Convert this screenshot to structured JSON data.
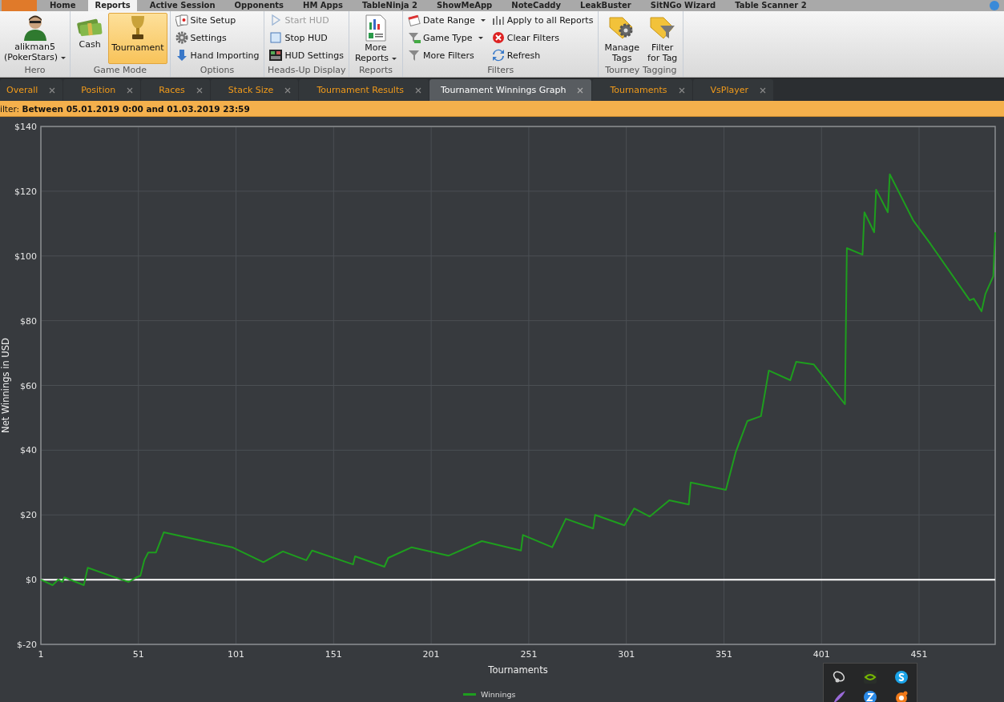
{
  "menu_tabs": [
    {
      "label": "Home",
      "selected": false
    },
    {
      "label": "Reports",
      "selected": true
    },
    {
      "label": "Active Session",
      "selected": false
    },
    {
      "label": "Opponents",
      "selected": false
    },
    {
      "label": "HM Apps",
      "selected": false
    },
    {
      "label": "TableNinja 2",
      "selected": false
    },
    {
      "label": "ShowMeApp",
      "selected": false
    },
    {
      "label": "NoteCaddy",
      "selected": false
    },
    {
      "label": "LeakBuster",
      "selected": false
    },
    {
      "label": "SitNGo Wizard",
      "selected": false
    },
    {
      "label": "Table Scanner 2",
      "selected": false
    }
  ],
  "ribbon": {
    "groups": [
      {
        "label": "Hero",
        "items": [
          {
            "kind": "hero",
            "label": "alikman5\n(PokerStars)",
            "dropdown": true
          }
        ]
      },
      {
        "label": "Game Mode",
        "items": [
          {
            "kind": "large",
            "label": "Cash",
            "selected": false
          },
          {
            "kind": "large",
            "label": "Tournament",
            "selected": true
          }
        ]
      },
      {
        "label": "Options",
        "items": [
          {
            "kind": "small",
            "label": "Site Setup"
          },
          {
            "kind": "small",
            "label": "Settings"
          },
          {
            "kind": "small",
            "label": "Hand Importing"
          }
        ]
      },
      {
        "label": "Heads-Up Display",
        "items": [
          {
            "kind": "small",
            "label": "Start HUD",
            "disabled": true
          },
          {
            "kind": "small",
            "label": "Stop HUD",
            "disabled": false
          },
          {
            "kind": "small",
            "label": "HUD Settings",
            "disabled": false
          }
        ]
      },
      {
        "label": "Reports",
        "items": [
          {
            "kind": "large",
            "label": "More\nReports",
            "dropdown": true,
            "selected": false
          }
        ]
      },
      {
        "label": "Filters",
        "items": [
          {
            "kind": "small",
            "label": "Date Range",
            "dropdown": true
          },
          {
            "kind": "small",
            "label": "Game Type",
            "dropdown": true
          },
          {
            "kind": "small",
            "label": "More Filters",
            "dropdown": false
          },
          {
            "kind": "small",
            "label": "Apply to all Reports",
            "dropdown": false
          },
          {
            "kind": "small",
            "label": "Clear Filters",
            "dropdown": false
          },
          {
            "kind": "small",
            "label": "Refresh",
            "dropdown": false
          }
        ]
      },
      {
        "label": "Tourney Tagging",
        "items": [
          {
            "kind": "large",
            "label": "Manage\nTags",
            "selected": false
          },
          {
            "kind": "large",
            "label": "Filter\nfor Tag",
            "selected": false
          }
        ]
      }
    ]
  },
  "tabs": [
    {
      "label": "Overall",
      "selected": false
    },
    {
      "label": "Position",
      "selected": false
    },
    {
      "label": "Races",
      "selected": false
    },
    {
      "label": "Stack Size",
      "selected": false
    },
    {
      "label": "Tournament Results",
      "selected": false
    },
    {
      "label": "Tournament Winnings Graph",
      "selected": true
    },
    {
      "label": "Tournaments",
      "selected": false
    },
    {
      "label": "VsPlayer",
      "selected": false
    }
  ],
  "filter_bar": {
    "text": "ilter: **Between 05.01.2019 0:00 and 01.03.2019 23:59**"
  },
  "chart": {
    "chart_data": {
      "type": "line",
      "xlabel": "Tournaments",
      "ylabel": "Net Winnings in USD",
      "x": [
        1,
        7,
        10,
        12,
        13,
        23,
        25,
        40,
        46,
        50,
        52,
        54,
        56,
        60,
        64,
        99,
        115,
        125,
        137,
        140,
        161,
        162,
        177,
        179,
        191,
        210,
        227,
        247,
        248,
        263,
        270,
        284,
        285,
        300,
        305,
        313,
        323,
        333,
        334,
        352,
        357,
        363,
        370,
        374,
        385,
        388,
        397,
        405,
        413,
        414,
        422,
        423,
        428,
        429,
        435,
        436,
        448,
        457,
        477,
        479,
        483,
        485,
        489,
        490
      ],
      "series": [
        {
          "name": "Winnings",
          "color": "#1e9e1e",
          "values": [
            0,
            -1.7,
            0,
            -0.7,
            0.7,
            -1.7,
            3.7,
            0.5,
            -0.7,
            0.7,
            1.2,
            6,
            8.4,
            8.4,
            14.6,
            10,
            5.4,
            8.7,
            6,
            9,
            4.7,
            7.2,
            4,
            6.7,
            10,
            7.4,
            11.9,
            9,
            13.8,
            10,
            18.8,
            15.8,
            20,
            16.8,
            22,
            19.5,
            24.5,
            23.2,
            30,
            27.7,
            39.3,
            49,
            50.5,
            64.6,
            61.6,
            67.3,
            66.5,
            60.4,
            54.2,
            102.4,
            100.4,
            113.5,
            107.3,
            120.5,
            113.5,
            125.2,
            111,
            103.6,
            86.3,
            86.8,
            82.9,
            88.3,
            93.7,
            107.3
          ]
        }
      ],
      "grid": true,
      "xlim": [
        1,
        490
      ],
      "ylim": [
        -20,
        140
      ],
      "xticks": [
        1,
        51,
        101,
        151,
        201,
        251,
        301,
        351,
        401,
        451
      ],
      "yticks": [
        {
          "value": -20,
          "label": "$-20"
        },
        {
          "value": 0,
          "label": "$0"
        },
        {
          "value": 20,
          "label": "$20"
        },
        {
          "value": 40,
          "label": "$40"
        },
        {
          "value": 60,
          "label": "$60"
        },
        {
          "value": 80,
          "label": "$80"
        },
        {
          "value": 100,
          "label": "$100"
        },
        {
          "value": 120,
          "label": "$120"
        },
        {
          "value": 140,
          "label": "$140"
        }
      ]
    }
  }
}
